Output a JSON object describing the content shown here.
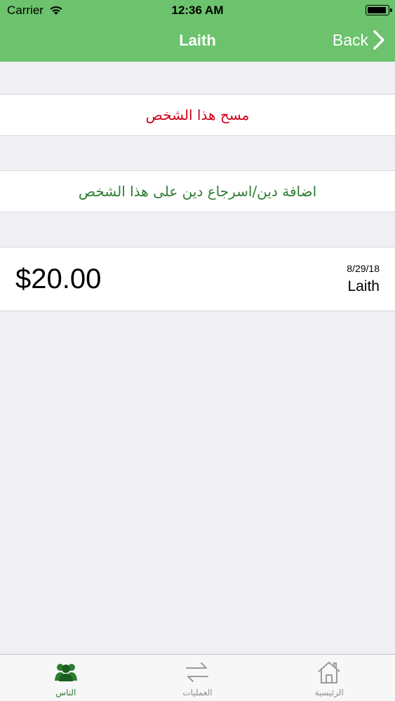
{
  "status": {
    "carrier": "Carrier",
    "time": "12:36 AM"
  },
  "nav": {
    "title": "Laith",
    "back_label": "Back"
  },
  "actions": {
    "delete_label": "مسح هذا الشخص",
    "add_label": "اضافة دين/اسرجاع دين على هذا الشخص"
  },
  "record": {
    "amount": "$20.00",
    "date": "8/29/18",
    "name": "Laith"
  },
  "tabs": [
    {
      "label": "الناس",
      "icon": "people-icon",
      "active": true
    },
    {
      "label": "العمليات",
      "icon": "transfer-arrows-icon",
      "active": false
    },
    {
      "label": "الرئيسية",
      "icon": "home-icon",
      "active": false
    }
  ],
  "colors": {
    "nav_green": "#6cc26d",
    "delete_red": "#d0021b",
    "add_green": "#2e7d32"
  }
}
